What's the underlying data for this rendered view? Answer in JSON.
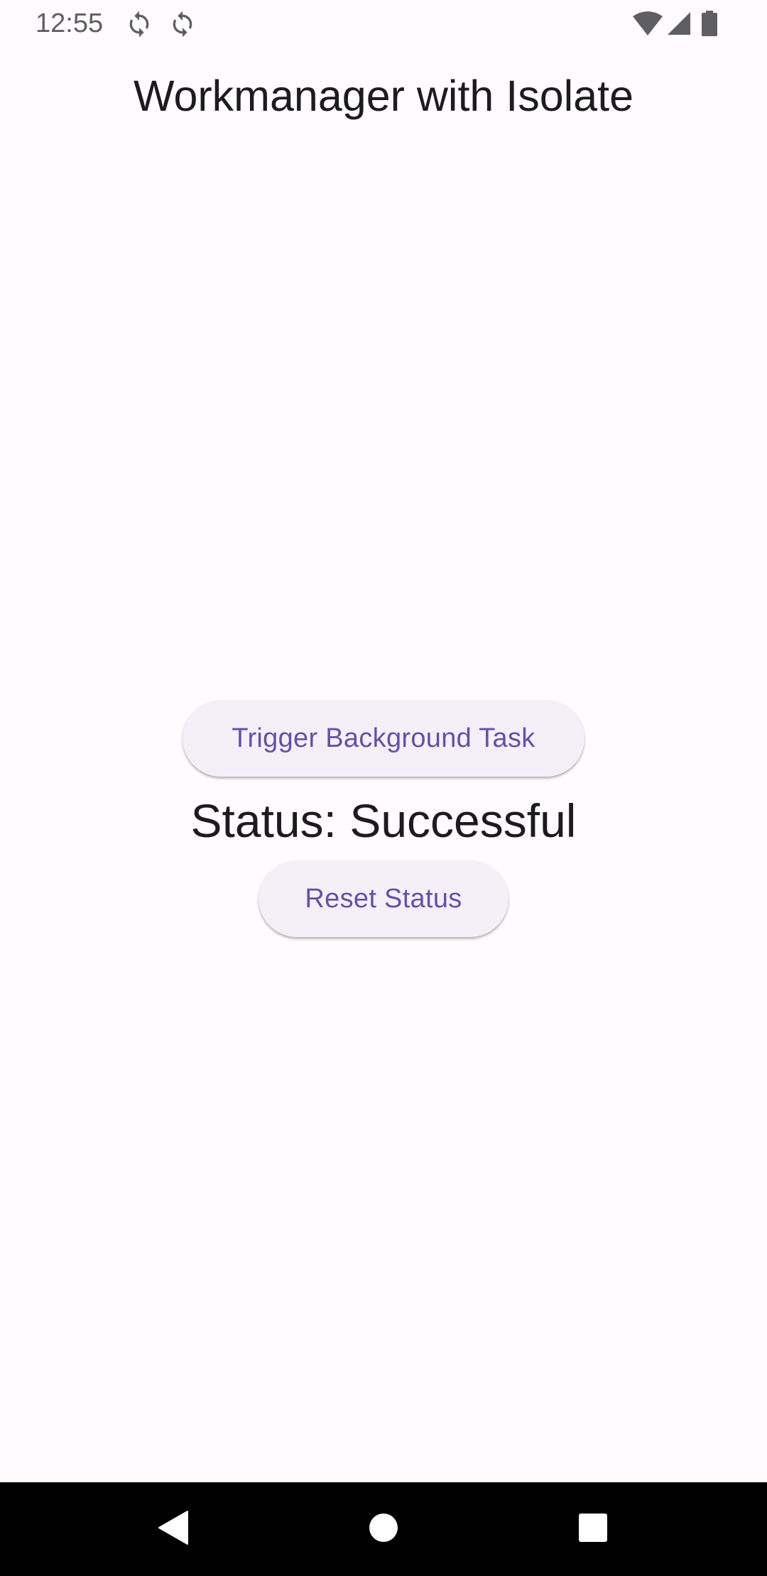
{
  "status_bar": {
    "time": "12:55",
    "icons": [
      "sync-icon",
      "sync-icon",
      "wifi-icon",
      "cellular-signal-icon",
      "battery-icon"
    ]
  },
  "app_bar": {
    "title": "Workmanager with Isolate"
  },
  "main": {
    "trigger_button_label": "Trigger Background Task",
    "status_text": "Status: Successful",
    "reset_button_label": "Reset Status"
  },
  "nav_bar": {
    "icons": [
      "back-icon",
      "home-icon",
      "recents-icon"
    ]
  },
  "colors": {
    "background": "#fffbfe",
    "button_background": "#f5eff8",
    "button_text": "#6750a4",
    "text_primary": "#1c1b1f",
    "nav_bar": "#000000"
  }
}
